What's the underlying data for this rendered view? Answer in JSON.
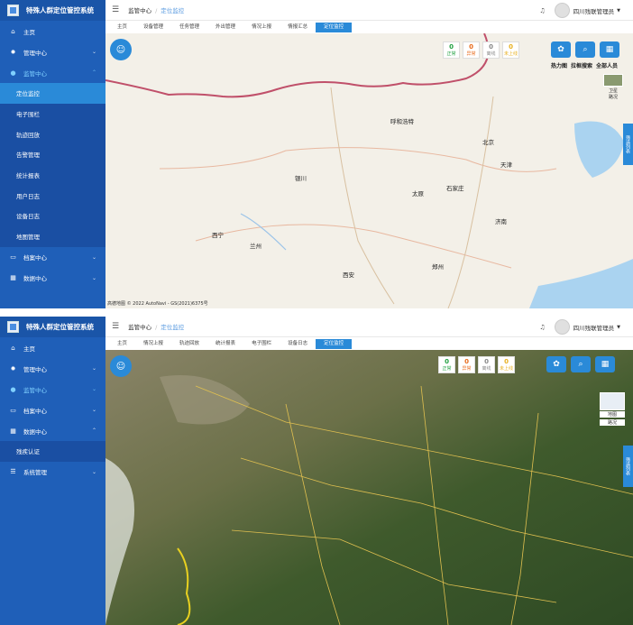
{
  "app": {
    "title": "特殊人群定位管控系统"
  },
  "header": {
    "breadcrumb_root": "监管中心",
    "breadcrumb_sep": "/",
    "breadcrumb_current": "定位监控",
    "user": "四川残联管理员"
  },
  "panel1": {
    "nav": [
      {
        "label": "主页"
      },
      {
        "label": "管理中心"
      },
      {
        "label": "监管中心"
      }
    ],
    "sub": [
      "定位监控",
      "电子围栏",
      "轨迹回放",
      "告警管理",
      "统计报表",
      "用户日志",
      "设备日志",
      "地图管理"
    ],
    "nav_after": [
      {
        "label": "档案中心"
      },
      {
        "label": "数据中心"
      }
    ],
    "tabs": [
      "主页",
      "设备管理",
      "任务管理",
      "外出管理",
      "情况上报",
      "情报汇总",
      "定位监控"
    ],
    "stats": [
      {
        "value": "0",
        "label": "正常",
        "color": "#20a040"
      },
      {
        "value": "0",
        "label": "异常",
        "color": "#e86a1a"
      },
      {
        "value": "0",
        "label": "离线",
        "color": "#888888"
      },
      {
        "value": "0",
        "label": "未上线",
        "color": "#e8b020"
      }
    ],
    "tools": [
      "热力图",
      "拉框搜索",
      "全部人员"
    ],
    "layer_label1": "卫星",
    "layer_label2": "路况",
    "side_tab": "筛选列表",
    "footer": "高德地图 © 2022 AutoNavi - GS(2021)6375号",
    "labels": [
      "呼和浩特",
      "北京",
      "天津",
      "石家庄",
      "太原",
      "银川",
      "兰州",
      "西宁",
      "济南",
      "郑州",
      "西安"
    ]
  },
  "panel2": {
    "nav": [
      {
        "label": "主页"
      },
      {
        "label": "管理中心"
      },
      {
        "label": "监管中心"
      },
      {
        "label": "档案中心"
      },
      {
        "label": "数据中心"
      }
    ],
    "sub": [
      "残疾认证"
    ],
    "nav_after": [
      {
        "label": "系统管理"
      }
    ],
    "tabs": [
      "主页",
      "情况上报",
      "轨迹回放",
      "统计报表",
      "电子围栏",
      "设备日志",
      "定位监控"
    ],
    "stats": [
      {
        "value": "0",
        "label": "正常",
        "color": "#20a040"
      },
      {
        "value": "0",
        "label": "异常",
        "color": "#e86a1a"
      },
      {
        "value": "0",
        "label": "离线",
        "color": "#888888"
      },
      {
        "value": "0",
        "label": "未上线",
        "color": "#e8b020"
      }
    ],
    "layer_label1": "地图",
    "layer_label2": "路况",
    "side_tab": "筛选列表"
  }
}
